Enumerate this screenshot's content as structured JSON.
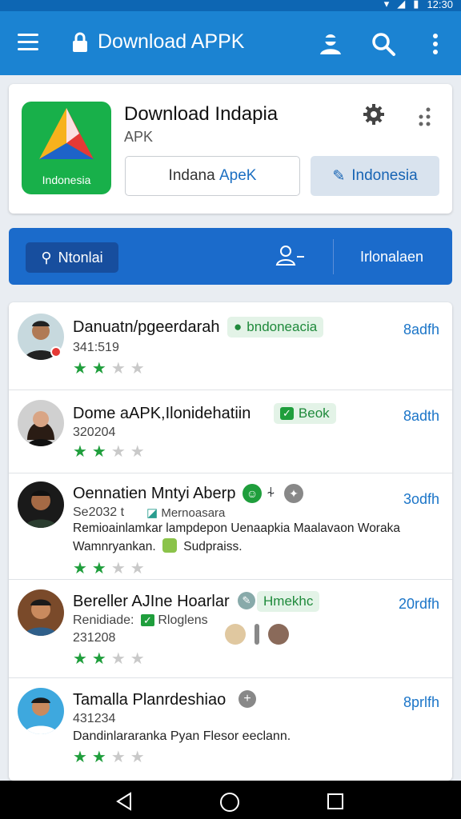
{
  "status": {
    "time": "12:30"
  },
  "appbar": {
    "title": "Download APPK"
  },
  "app": {
    "icon_label": "Indonesia",
    "title": "Download Indapia",
    "subtitle": "APK",
    "btn_outline_prefix": "Indana ",
    "btn_outline_blue": "ApeK",
    "btn_filled": "Indonesia"
  },
  "tabs": {
    "first": "Ntonlai",
    "third": "Irlonalaen"
  },
  "rows": [
    {
      "name": "Danuatn/pgeerdarah",
      "chip": "bndoneacia",
      "num": "341:519",
      "time": "8adfh"
    },
    {
      "name": "Dome aAPK,Ilonidehatiin",
      "chip": "Beok",
      "num": "320204",
      "time": "8adth"
    },
    {
      "name": "Oennatien Mntyi Aberp",
      "num": "Se2032 t",
      "num_extra": "Mernoasara",
      "desc1": "Remioainlamkar lampdepon Uenaapkia Maalavaon Woraka",
      "desc2": "Wamnryankan.",
      "desc2b": "Sudpraiss.",
      "time": "3odfh"
    },
    {
      "name": "Bereller AJIne Hoarlar",
      "chip": "Hmekhc",
      "num": "Renidiade:",
      "num_extra": "Rloglens",
      "num2": "231208",
      "time": "20rdfh"
    },
    {
      "name": "Tamalla Planrdeshiao",
      "num": "431234",
      "desc1": "Dandinlararanka Pyan Flesor eeclann.",
      "time": "8prlfh"
    }
  ],
  "colors": {
    "appbar": "#1b83d2",
    "tabs": "#1b6bcb",
    "accent_green": "#1f9e3c",
    "time_blue": "#1b75c8"
  }
}
